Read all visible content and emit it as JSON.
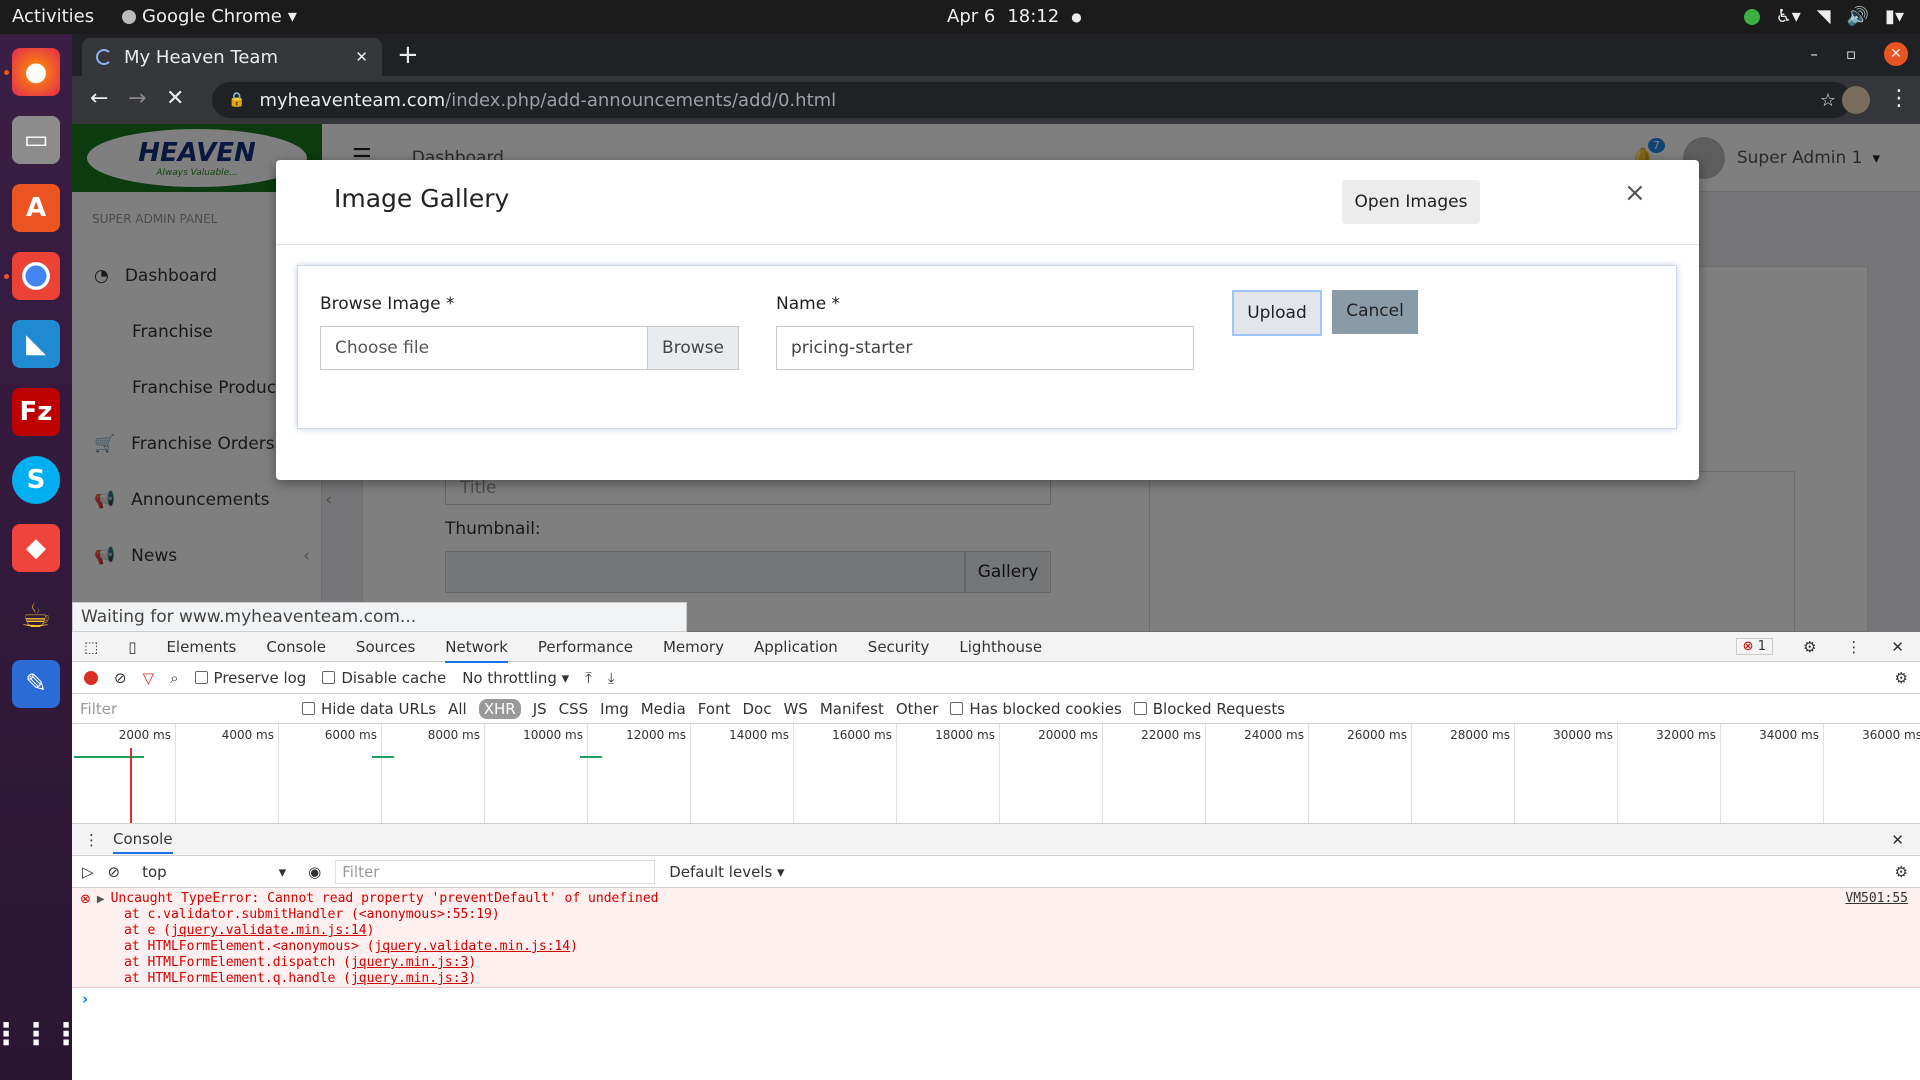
{
  "system": {
    "activities": "Activities",
    "app_name": "Google Chrome",
    "date": "Apr 6",
    "time": "18:12"
  },
  "browser": {
    "tab_title": "My Heaven Team",
    "url_domain": "myheaventeam.com",
    "url_path": "/index.php/add-announcements/add/0.html",
    "status_text": "Waiting for www.myheaventeam.com..."
  },
  "site": {
    "logo_text": "HEAVEN",
    "logo_tagline": "Always Valuable...",
    "header_title": "Dashboard",
    "notification_count": "7",
    "user_name": "Super Admin 1",
    "panel_label": "SUPER ADMIN PANEL",
    "sidebar": [
      {
        "label": "Dashboard",
        "icon": "dashboard-icon"
      },
      {
        "label": "Franchise",
        "icon": ""
      },
      {
        "label": "Franchise Product",
        "icon": ""
      },
      {
        "label": "Franchise Orders",
        "icon": "cart-icon"
      },
      {
        "label": "Announcements",
        "icon": "bullhorn-icon"
      },
      {
        "label": "News",
        "icon": "bullhorn-icon"
      }
    ],
    "form": {
      "title_placeholder": "Title",
      "thumbnail_label": "Thumbnail:",
      "gallery_button": "Gallery"
    }
  },
  "modal": {
    "title": "Image Gallery",
    "open_images": "Open Images",
    "close": "×",
    "browse_label": "Browse Image *",
    "file_placeholder": "Choose file",
    "browse_button": "Browse",
    "name_label": "Name *",
    "name_value": "pricing-starter",
    "upload_button": "Upload",
    "cancel_button": "Cancel"
  },
  "devtools": {
    "tabs": [
      "Elements",
      "Console",
      "Sources",
      "Network",
      "Performance",
      "Memory",
      "Application",
      "Security",
      "Lighthouse"
    ],
    "active_tab": "Network",
    "error_count": "1",
    "preserve_log": "Preserve log",
    "disable_cache": "Disable cache",
    "throttling": "No throttling",
    "filter_placeholder": "Filter",
    "hide_data_urls": "Hide data URLs",
    "types": [
      "All",
      "XHR",
      "JS",
      "CSS",
      "Img",
      "Media",
      "Font",
      "Doc",
      "WS",
      "Manifest",
      "Other"
    ],
    "active_type": "XHR",
    "has_blocked_cookies": "Has blocked cookies",
    "blocked_requests": "Blocked Requests",
    "timeline_ticks": [
      "2000 ms",
      "4000 ms",
      "6000 ms",
      "8000 ms",
      "10000 ms",
      "12000 ms",
      "14000 ms",
      "16000 ms",
      "18000 ms",
      "20000 ms",
      "22000 ms",
      "24000 ms",
      "26000 ms",
      "28000 ms",
      "30000 ms",
      "32000 ms",
      "34000 ms",
      "36000 ms"
    ],
    "drawer_title": "Console",
    "context": "top",
    "console_filter": "Filter",
    "levels": "Default levels",
    "error_message": "Uncaught TypeError: Cannot read property 'preventDefault' of undefined",
    "error_source": "VM501:55",
    "stack": [
      {
        "text": "at c.validator.submitHandler (<anonymous>:55:19)",
        "link": ""
      },
      {
        "text": "at e (",
        "link": "jquery.validate.min.js:14",
        "tail": ")"
      },
      {
        "text": "at HTMLFormElement.<anonymous> (",
        "link": "jquery.validate.min.js:14",
        "tail": ")"
      },
      {
        "text": "at HTMLFormElement.dispatch (",
        "link": "jquery.min.js:3",
        "tail": ")"
      },
      {
        "text": "at HTMLFormElement.q.handle (",
        "link": "jquery.min.js:3",
        "tail": ")"
      }
    ]
  }
}
